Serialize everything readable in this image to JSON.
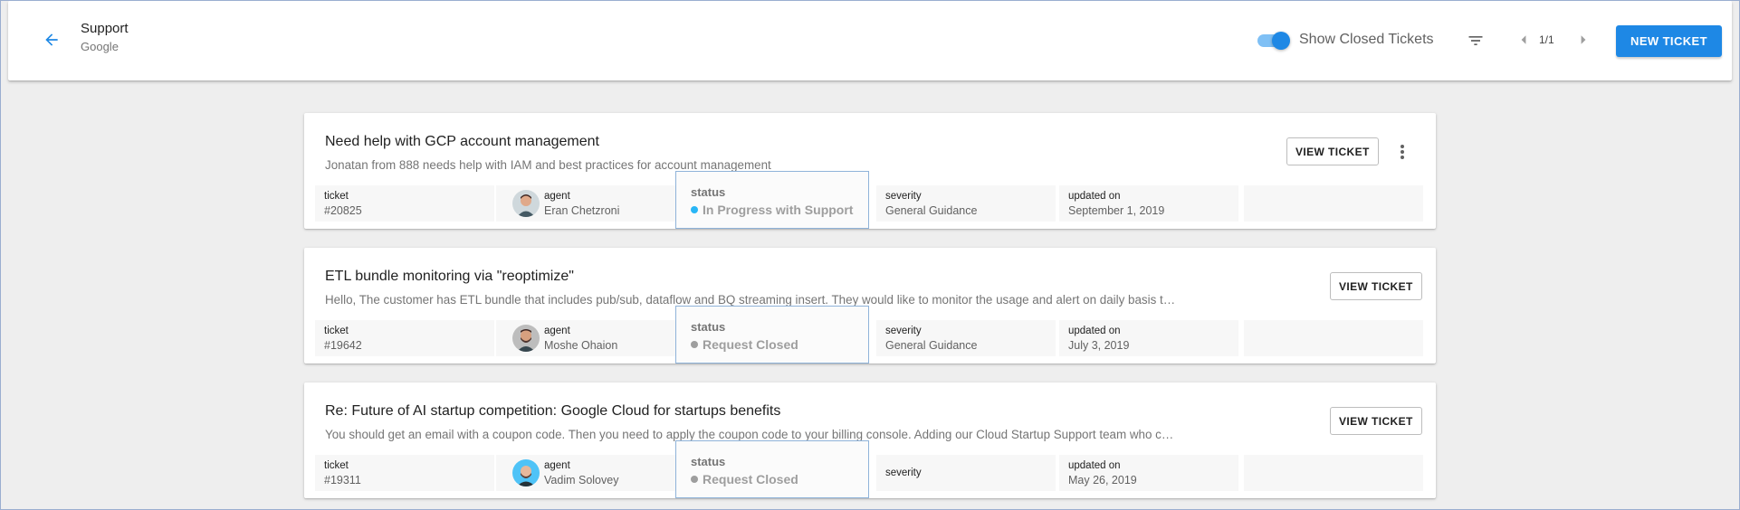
{
  "header": {
    "title": "Support",
    "subtitle": "Google",
    "toggle_label": "Show Closed Tickets",
    "toggle_on": true,
    "pager": "1/1",
    "new_ticket_label": "NEW TICKET",
    "icons": {
      "back": "arrow-left-icon",
      "filter": "filter-icon",
      "prev": "chevron-left-icon",
      "next": "chevron-right-icon"
    }
  },
  "colors": {
    "accent": "#1e88e5",
    "status_in_progress": "#29b6f6",
    "status_closed": "#9e9e9e"
  },
  "labels": {
    "ticket": "ticket",
    "agent": "agent",
    "status": "status",
    "severity": "severity",
    "updated_on": "updated on",
    "view_ticket": "VIEW TICKET"
  },
  "tickets": [
    {
      "title": "Need help with GCP account management",
      "description": "Jonatan from 888 needs help with IAM and best practices for account management",
      "ticket": "#20825",
      "agent": "Eran Chetzroni",
      "status": "In Progress with Support",
      "severity": "General Guidance",
      "updated_on": "September 1, 2019",
      "has_menu": true
    },
    {
      "title": "ETL bundle monitoring via \"reoptimize\"",
      "description": "Hello, The customer has ETL bundle that includes pub/sub, dataflow and BQ streaming insert. They would like to monitor the usage and alert on daily basis t…",
      "ticket": "#19642",
      "agent": "Moshe Ohaion",
      "status": "Request Closed",
      "severity": "General Guidance",
      "updated_on": "July 3, 2019",
      "has_menu": false
    },
    {
      "title": "Re: Future of AI startup competition: Google Cloud for startups benefits",
      "description": "You should get an email with a coupon code. Then you need to apply the coupon code to your billing console. Adding our Cloud Startup Support team who c…",
      "ticket": "#19311",
      "agent": "Vadim Solovey",
      "status": "Request Closed",
      "severity": "",
      "updated_on": "May 26, 2019",
      "has_menu": false
    }
  ]
}
